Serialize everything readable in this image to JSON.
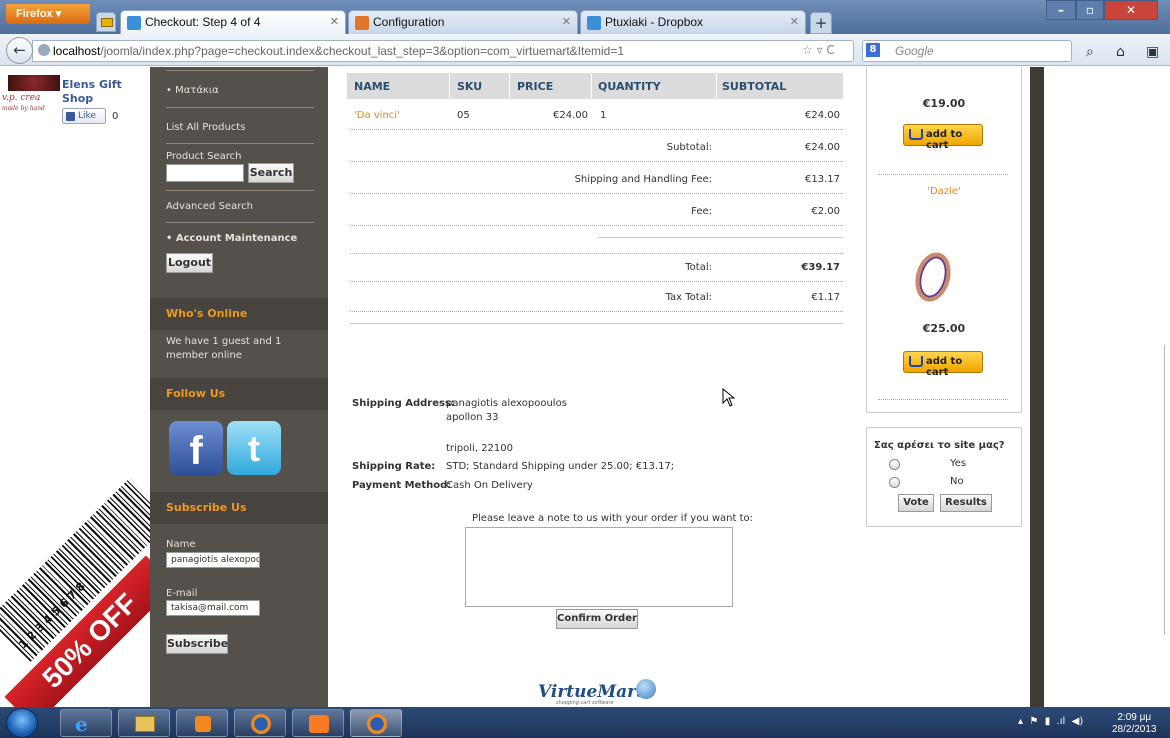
{
  "browser": {
    "menu_button": "Firefox ▾",
    "tabs": [
      {
        "label": "Checkout: Step 4 of 4",
        "color": "#3b8fd6"
      },
      {
        "label": "Configuration",
        "color": "#e0762a"
      },
      {
        "label": "Ptuxiaki - Dropbox",
        "color": "#3b8fd6"
      }
    ],
    "new_tab": "+",
    "url_host": "localhost",
    "url_path": "/joomla/index.php?page=checkout.index&checkout_last_step=3&option=com_virtuemart&Itemid=1",
    "url_tools": "☆ ▿ C",
    "search_placeholder": "Google",
    "search_engine_letter": "8"
  },
  "left_widget": {
    "logo_text": "v.p. crea",
    "logo_sub": "made by hand",
    "shop_name_1": "Elens Gift",
    "shop_name_2": "Shop",
    "like_label": "Like",
    "like_count": "0",
    "banner_text": "50% OFF",
    "barcode_digits": "1 2 3 4 5 6 7 8"
  },
  "sidebar": {
    "menu_item": "• Ματάκια",
    "list_all": "List All Products",
    "product_search_label": "Product Search",
    "search_button": "Search",
    "advanced_search": "Advanced Search",
    "account_maintenance": "• Account Maintenance",
    "logout_button": "Logout",
    "whos_online_title": "Who's Online",
    "whos_online_text_1": "We have 1 guest and 1",
    "whos_online_text_2": "member online",
    "follow_us_title": "Follow Us",
    "facebook_letter": "f",
    "twitter_letter": "t",
    "subscribe_title": "Subscribe Us",
    "name_label": "Name",
    "name_value": "panagiotis alexopooulos",
    "email_label": "E-mail",
    "email_value": "takisa@mail.com",
    "subscribe_button": "Subscribe"
  },
  "cart": {
    "headers": [
      "NAME",
      "SKU",
      "PRICE",
      "QUANTITY",
      "SUBTOTAL"
    ],
    "item": {
      "name": "'Da vinci'",
      "sku": "05",
      "price": "€24.00",
      "quantity": "1",
      "subtotal": "€24.00"
    },
    "totals": [
      {
        "label": "Subtotal:",
        "value": "€24.00"
      },
      {
        "label": "Shipping and Handling Fee:",
        "value": "€13.17"
      },
      {
        "label": "Fee:",
        "value": "€2.00"
      },
      {
        "label": "Total:",
        "value": "€39.17"
      },
      {
        "label": "Tax Total:",
        "value": "€1.17"
      }
    ]
  },
  "order": {
    "shipping_address_label": "Shipping Address:",
    "address_line_1": "panagiotis alexopooulos",
    "address_line_2": "apollon 33",
    "address_line_3": "tripoli, 22100",
    "shipping_rate_label": "Shipping Rate:",
    "shipping_rate_value": "STD; Standard Shipping under 25.00; €13.17;",
    "payment_label": "Payment Method:",
    "payment_value": "Cash On Delivery",
    "note_prompt": "Please leave a note to us with your order if you want to:",
    "confirm_button": "Confirm Order",
    "footer_logo": "VirtueMart",
    "footer_logo_sub": "shopping cart software"
  },
  "right_panel": {
    "price_1": "€19.00",
    "add_to_cart": "add to cart",
    "product_2": "'Dazle'",
    "price_2": "€25.00",
    "poll_question": "Σας αρέσει το site μας?",
    "poll_options": [
      "Yes",
      "No"
    ],
    "vote_button": "Vote",
    "results_button": "Results"
  },
  "taskbar": {
    "time": "2:09 μμ",
    "date": "28/2/2013"
  }
}
